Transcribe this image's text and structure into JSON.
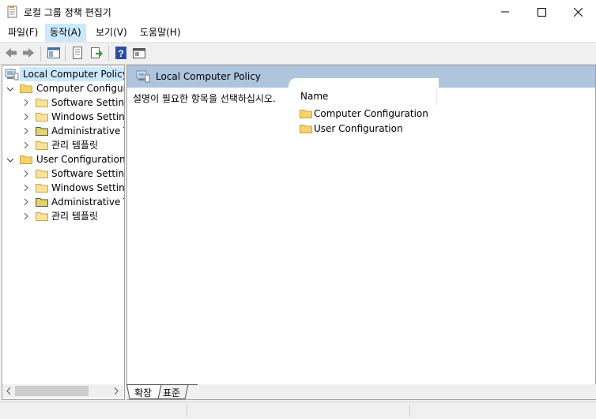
{
  "window": {
    "title": "로컬 그룹 정책 편집기"
  },
  "menu": {
    "file": "파일(F)",
    "action": "동작(A)",
    "view": "보기(V)",
    "help": "도움말(H)"
  },
  "tree": {
    "root": "Local Computer Policy",
    "computer": {
      "label": "Computer Configura",
      "children": [
        "Software Settings",
        "Windows Setting",
        "Administrative Te",
        "관리 템플릿"
      ]
    },
    "user": {
      "label": "User Configuration",
      "children": [
        "Software Settings",
        "Windows Setting",
        "Administrative Te",
        "관리 템플릿"
      ]
    }
  },
  "main": {
    "header": "Local Computer Policy",
    "description": "설명이 필요한 항목을 선택하십시오.",
    "column_name": "Name",
    "items": [
      "Computer Configuration",
      "User Configuration"
    ]
  },
  "tabs": {
    "extended": "확장",
    "standard": "표준"
  },
  "colors": {
    "selection": "#cce8ff",
    "header_bar": "#aec5dd",
    "folder": "#f5d36b"
  }
}
